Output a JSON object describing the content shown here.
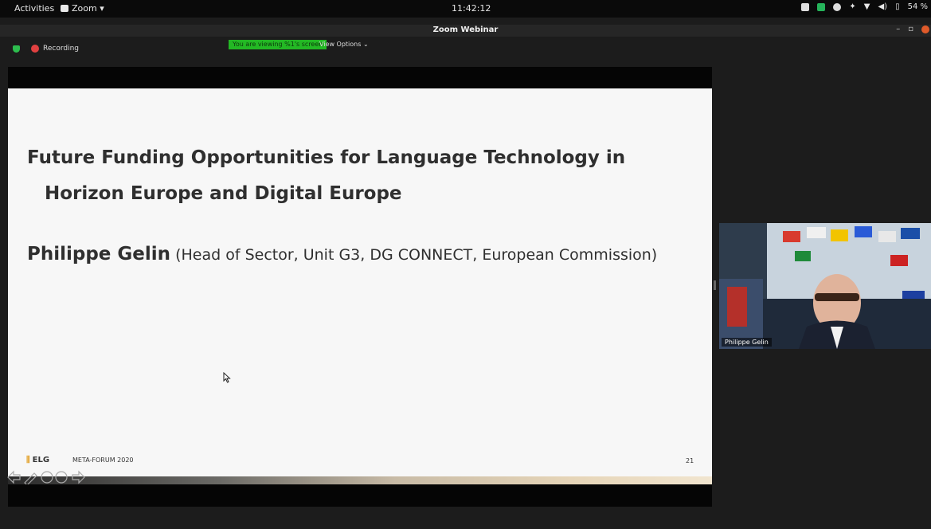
{
  "topbar": {
    "activities": "Activities",
    "app_menu": "Zoom ▾",
    "clock": "11:42:12",
    "battery": "54 %"
  },
  "window": {
    "title": "Zoom Webinar",
    "minimize": "–",
    "restore": "▫"
  },
  "status": {
    "recording": "Recording",
    "viewing_banner": "You are viewing %1's screen",
    "view_options": "View Options ⌄"
  },
  "slide": {
    "title_line1": "Future Funding Opportunities for Language Technology in",
    "title_line2": "Horizon Europe and Digital Europe",
    "speaker_name": "Philippe Gelin",
    "speaker_role": " (Head of Sector, Unit G3, DG CONNECT, European Commission)",
    "logo": "ELG",
    "event": "META-FORUM 2020",
    "page": "21"
  },
  "video": {
    "participant_name": "Philippe Gelin"
  },
  "colors": {
    "viewing_banner": "#23b824",
    "recording_dot": "#e04040",
    "slide_bg": "#f7f7f7"
  }
}
